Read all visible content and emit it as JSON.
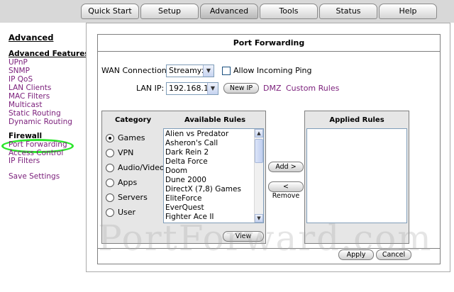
{
  "nav": {
    "tabs": [
      {
        "label": "Quick Start"
      },
      {
        "label": "Setup"
      },
      {
        "label": "Advanced",
        "active": true
      },
      {
        "label": "Tools"
      },
      {
        "label": "Status"
      },
      {
        "label": "Help"
      }
    ]
  },
  "sidebar": {
    "title": "Advanced",
    "features_header": "Advanced Features",
    "features": [
      "UPnP",
      "SNMP",
      "IP QoS",
      "LAN Clients",
      "MAC Filters",
      "Multicast",
      "Static Routing",
      "Dynamic Routing"
    ],
    "firewall_header": "Firewall",
    "firewall_items": [
      "Port Forwarding",
      "Access Control",
      "IP Filters"
    ],
    "save_settings": "Save Settings"
  },
  "main": {
    "title": "Port Forwarding",
    "wan_label": "WAN Connection:",
    "wan_value": "Streamyx",
    "allow_ping_label": "Allow Incoming Ping",
    "lan_ip_label": "LAN IP:",
    "lan_ip_value": "192.168.1.2",
    "new_ip_button": "New IP",
    "dmz_link": "DMZ",
    "custom_rules_link": "Custom Rules",
    "category_header": "Category",
    "available_header": "Available Rules",
    "applied_header": "Applied Rules",
    "categories": [
      "Games",
      "VPN",
      "Audio/Video",
      "Apps",
      "Servers",
      "User"
    ],
    "selected_category": "Games",
    "available_rules": [
      "Alien vs Predator",
      "Asheron's Call",
      "Dark Rein 2",
      "Delta Force",
      "Doom",
      "Dune 2000",
      "DirectX (7,8) Games",
      "EliteForce",
      "EverQuest",
      "Fighter Ace II"
    ],
    "add_button": "Add >",
    "remove_button": "< Remove",
    "view_button": "View",
    "apply_button": "Apply",
    "cancel_button": "Cancel"
  },
  "watermark": "PortForward.com",
  "colors": {
    "link": "#7a1d7a",
    "highlight_ring": "#2ce62c",
    "panel_bg": "#e6e6e6"
  }
}
